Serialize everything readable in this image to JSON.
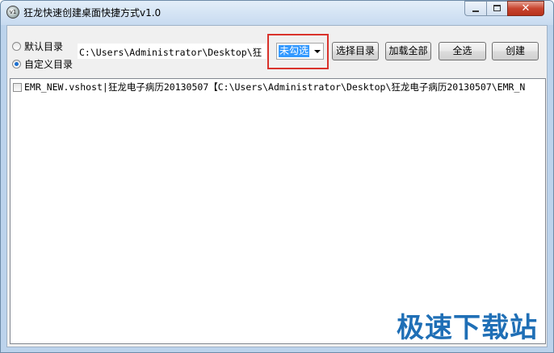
{
  "window": {
    "title": "狂龙快速创建桌面快捷方式v1.0",
    "icon": "app-dragon-icon",
    "controls": {
      "minimize": "minimize-icon",
      "maximize": "maximize-icon",
      "close": "✕"
    }
  },
  "directory_mode": {
    "options": [
      {
        "label": "默认目录",
        "checked": false
      },
      {
        "label": "自定义目录",
        "checked": true
      }
    ]
  },
  "path_field": {
    "value": "C:\\Users\\Administrator\\Desktop\\狂"
  },
  "filter_combo": {
    "selected": "未勾选"
  },
  "buttons": {
    "select_dir": "选择目录",
    "load_all": "加载全部",
    "select_all": "全选",
    "create": "创建"
  },
  "list": {
    "items": [
      {
        "text": "EMR_NEW.vshost|狂龙电子病历20130507【C:\\Users\\Administrator\\Desktop\\狂龙电子病历20130507\\EMR_N",
        "checked": false
      }
    ]
  },
  "watermark": {
    "text": "极速下载站"
  }
}
